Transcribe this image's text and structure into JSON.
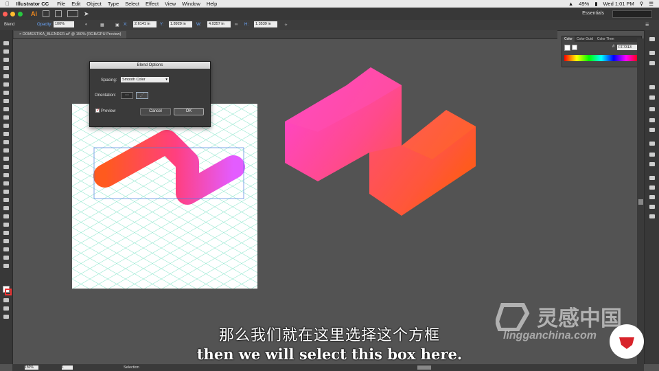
{
  "menubar": {
    "app_name": "Illustrator CC",
    "items": [
      "File",
      "Edit",
      "Object",
      "Type",
      "Select",
      "Effect",
      "View",
      "Window",
      "Help"
    ],
    "battery": "49%",
    "clock": "Wed 1:01 PM"
  },
  "appbar": {
    "logo": "Ai",
    "workspace": "Essentials"
  },
  "control": {
    "mode": "Blend",
    "opacity_label": "Opacity:",
    "opacity_value": "100%",
    "x_label": "X:",
    "x_value": "2.6141 in",
    "y_label": "Y:",
    "y_value": "1.8929 in",
    "w_label": "W:",
    "w_value": "4.0357 in",
    "h_label": "H:",
    "h_value": "1.3539 in"
  },
  "document": {
    "tab_title": "DOMESTIKA_BLENDER.ai* @ 150% (RGB/GPU Preview)"
  },
  "dialog": {
    "title": "Blend Options",
    "spacing_label": "Spacing:",
    "spacing_value": "Smooth Color",
    "orientation_label": "Orientation:",
    "preview_label": "Preview",
    "preview_checked": true,
    "cancel_label": "Cancel",
    "ok_label": "OK"
  },
  "color_panel": {
    "tabs": [
      "Color",
      "Color Guid",
      "Color Then"
    ],
    "hex_label": "#",
    "hex_value": "FF7313"
  },
  "status": {
    "zoom": "150%",
    "tool": "Selection",
    "page": "1"
  },
  "subtitles": {
    "chinese": "那么我们就在这里选择这个方框",
    "english": "then we will select this box here."
  },
  "watermark": {
    "chinese": "灵感中国",
    "english": "lingganchina.com"
  },
  "colors": {
    "shape_pink": "#ff3fbf",
    "shape_orange": "#ff5a1e",
    "grid": "#7fe3c4",
    "accent": "#4a90e2"
  }
}
